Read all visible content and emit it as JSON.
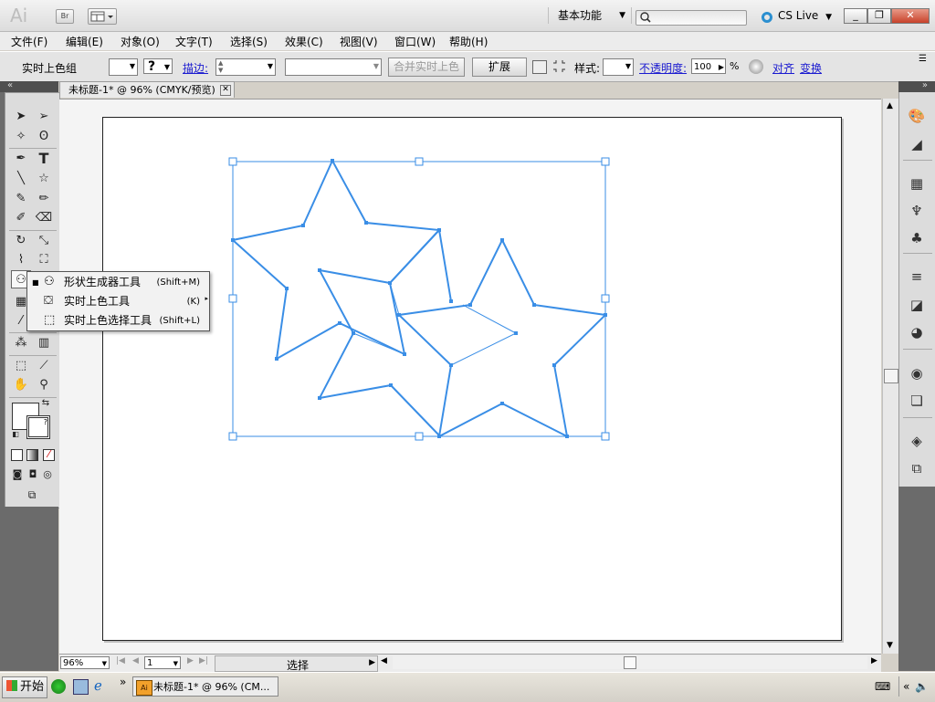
{
  "app": {
    "logo": "Ai",
    "bridge_label": "Br",
    "workspace": "基本功能",
    "cs_live": "CS Live",
    "window_controls": {
      "minimize": "_",
      "restore": "❐",
      "close": "✕"
    }
  },
  "menu": [
    "文件(F)",
    "编辑(E)",
    "对象(O)",
    "文字(T)",
    "选择(S)",
    "效果(C)",
    "视图(V)",
    "窗口(W)",
    "帮助(H)"
  ],
  "control_bar": {
    "label": "实时上色组",
    "question_mark": "?",
    "stroke_label": "描边:",
    "merge_button": "合并实时上色",
    "expand_button": "扩展",
    "style_label": "样式:",
    "opacity_label": "不透明度:",
    "opacity_value": "100",
    "opacity_unit": "%",
    "align_link": "对齐",
    "transform_link": "变换"
  },
  "document": {
    "tab_title": "未标题-1* @ 96% (CMYK/预览)",
    "tab_close": "✕"
  },
  "flyout": [
    {
      "label": "形状生成器工具",
      "shortcut": "(Shift+M)",
      "selected": true
    },
    {
      "label": "实时上色工具",
      "shortcut": "(K)",
      "selected": false
    },
    {
      "label": "实时上色选择工具",
      "shortcut": "(Shift+L)",
      "selected": false
    }
  ],
  "status": {
    "zoom": "96%",
    "page": "1",
    "status_text": "选择"
  },
  "taskbar": {
    "start": "开始",
    "active_window": "未标题-1* @ 96% (CM...",
    "more": "»",
    "tray_more": "«"
  },
  "colors": {
    "path_stroke": "#3a8ee6",
    "accent_link": "#1a1ad0"
  }
}
